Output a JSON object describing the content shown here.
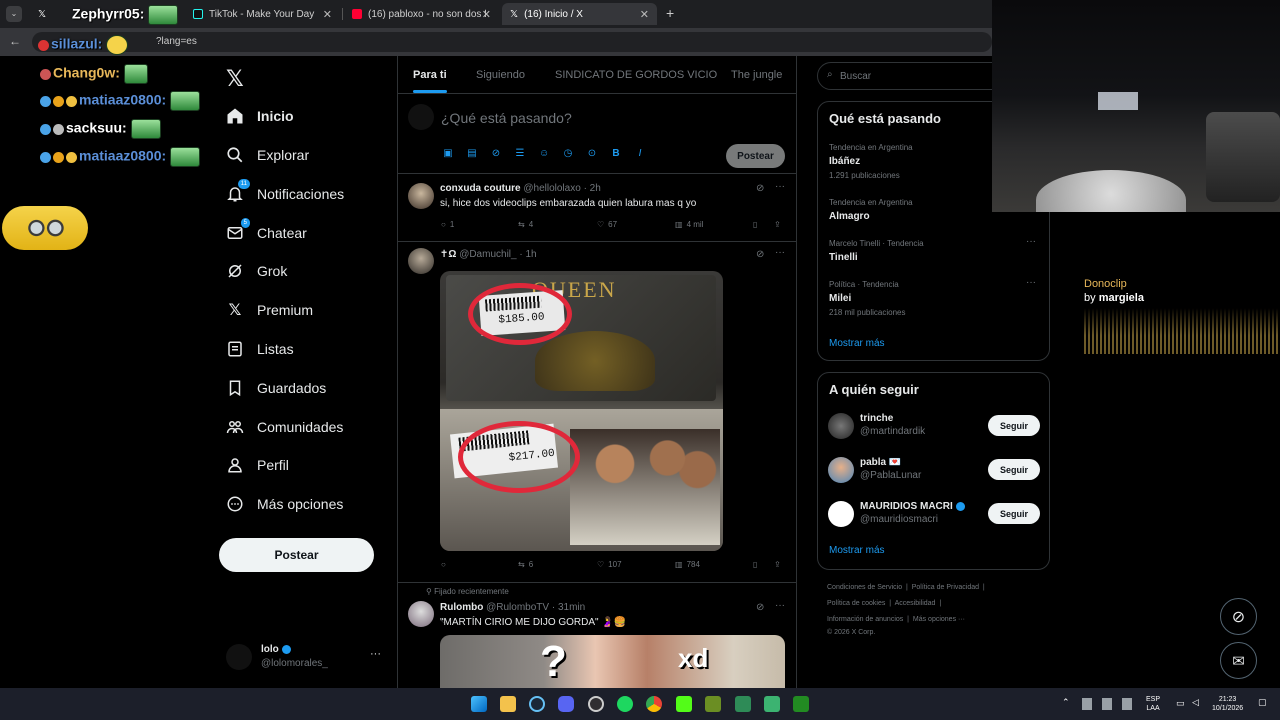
{
  "browser": {
    "tabs": [
      {
        "label": "",
        "title": "X"
      },
      {
        "label": "TikTok - Make Your Day"
      },
      {
        "label": "(16) pabloxo - no son dos f son"
      },
      {
        "label": "(16) Inicio / X"
      }
    ],
    "url": "?lang=es",
    "new_tab": "+"
  },
  "overlay": {
    "chat": [
      {
        "user": "Zephyrr05:",
        "color": "#ffffff"
      },
      {
        "user": "sillazul:",
        "color": "#5b8fd8"
      },
      {
        "user": "Chang0w:",
        "color": "#e8b85a"
      },
      {
        "user": "matiaaz0800:",
        "color": "#5b8fd8"
      },
      {
        "user": "sacksuu:",
        "color": "#ffffff"
      },
      {
        "user": "matiaaz0800:",
        "color": "#5b8fd8"
      }
    ],
    "donoclip_title": "Donoclip",
    "donoclip_by": "by",
    "donoclip_user": "margiela"
  },
  "nav": {
    "items": [
      {
        "label": "Inicio",
        "icon": "home-icon"
      },
      {
        "label": "Explorar",
        "icon": "search-icon"
      },
      {
        "label": "Notificaciones",
        "icon": "bell-icon",
        "badge": "11"
      },
      {
        "label": "Chatear",
        "icon": "mail-icon",
        "badge": "5"
      },
      {
        "label": "Grok",
        "icon": "grok-icon"
      },
      {
        "label": "Premium",
        "icon": "x-icon"
      },
      {
        "label": "Listas",
        "icon": "list-icon"
      },
      {
        "label": "Guardados",
        "icon": "bookmark-icon"
      },
      {
        "label": "Comunidades",
        "icon": "people-icon"
      },
      {
        "label": "Perfil",
        "icon": "person-icon"
      },
      {
        "label": "Más opciones",
        "icon": "more-icon"
      }
    ],
    "post_button": "Postear",
    "account": {
      "name": "lolo",
      "handle": "@lolomorales_",
      "more": "···"
    }
  },
  "feed": {
    "tabs": [
      "Para ti",
      "Siguiendo",
      "SINDICATO DE GORDOS VICIO",
      "The jungle"
    ],
    "compose_placeholder": "¿Qué está pasando?",
    "compose_button": "Postear",
    "posts": [
      {
        "name": "conxuda couture",
        "handle": "@hellololaxo",
        "time": "· 2h",
        "text": "si, hice dos videoclips embarazada quien labura mas q yo",
        "replies": "1",
        "reposts": "4",
        "likes": "67",
        "views": "4 mil"
      },
      {
        "name": "✝Ω",
        "handle": "@Damuchil_",
        "time": "· 1h",
        "text": "",
        "image_texts": [
          "$185.00",
          "$217.00",
          "QUEEN"
        ],
        "replies": "",
        "reposts": "6",
        "likes": "107",
        "views": "784"
      },
      {
        "pinned": "Fijado recientemente",
        "name": "Rulombo",
        "handle": "@RulomboTV",
        "time": "· 31min",
        "text": "\"MARTÍN CIRIO ME DIJO GORDA\" 🤰🍔",
        "image_texts": [
          "?",
          "xd"
        ]
      }
    ]
  },
  "sidebar": {
    "search_placeholder": "Buscar",
    "trends_title": "Qué está pasando",
    "trends": [
      {
        "context": "Tendencia en Argentina",
        "topic": "Ibáñez",
        "count": "1.291 publicaciones"
      },
      {
        "context": "Tendencia en Argentina",
        "topic": "Almagro",
        "count": ""
      },
      {
        "context": "Marcelo Tinelli · Tendencia",
        "topic": "Tinelli",
        "count": ""
      },
      {
        "context": "Política · Tendencia",
        "topic": "Milei",
        "count": "218 mil publicaciones"
      }
    ],
    "trends_more": "Mostrar más",
    "follow_title": "A quién seguir",
    "follow": [
      {
        "name": "trinche",
        "handle": "@martindardik",
        "button": "Seguir"
      },
      {
        "name": "pabla 💌",
        "handle": "@PablaLunar",
        "button": "Seguir"
      },
      {
        "name": "MAURIDIOS MACRI",
        "handle": "@mauridiosmacri",
        "button": "Seguir"
      }
    ],
    "follow_more": "Mostrar más",
    "footer": {
      "line1a": "Condiciones de Servicio",
      "line1b": "Política de Privacidad",
      "line2a": "Política de cookies",
      "line2b": "Accesibilidad",
      "line3a": "Información de anuncios",
      "line3b": "Más opciones ···",
      "copyright": "© 2026 X Corp."
    }
  },
  "taskbar": {
    "lang": "ESP",
    "layout": "LAA",
    "time": "21:23",
    "date": "10/1/2026"
  },
  "colors": {
    "accent": "#1d9bf0",
    "bg": "#000000",
    "border": "#2f3336"
  }
}
